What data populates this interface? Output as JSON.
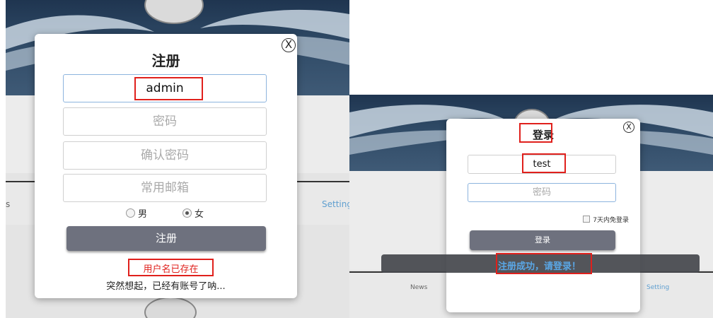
{
  "register_dialog": {
    "close_icon": "X",
    "title": "注册",
    "username_value": "admin",
    "password_placeholder": "密码",
    "confirm_password_placeholder": "确认密码",
    "email_placeholder": "常用邮箱",
    "gender_male": "男",
    "gender_female": "女",
    "gender_selected": "女",
    "submit_label": "注册",
    "error_message": "用户名已存在",
    "login_link": "突然想起，已经有账号了呐..."
  },
  "register_background": {
    "nav_left_fragment": "s",
    "nav_right_fragment": "Setting"
  },
  "login_dialog": {
    "close_icon": "X",
    "title": "登录",
    "username_value": "test",
    "password_placeholder": "密码",
    "remember_label": "7天内免登录",
    "submit_label": "登录"
  },
  "login_background": {
    "nav_news": "News",
    "nav_setting": "Setting"
  },
  "toast": {
    "message": "注册成功，请登录！"
  },
  "colors": {
    "highlight_red": "#e0201c",
    "button_gray": "#6e717e",
    "toast_blue": "#5aa7e6",
    "focus_blue": "#8db4de"
  }
}
